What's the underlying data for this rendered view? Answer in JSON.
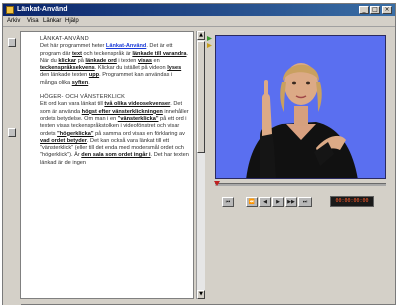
{
  "window": {
    "title": "Länkat-Använd",
    "controls": {
      "minimize": "_",
      "maximize": "□",
      "close": "×"
    }
  },
  "menubar": {
    "items": [
      "Arkiv",
      "Visa",
      "Länkar",
      "Hjälp"
    ]
  },
  "document": {
    "heading1": "LÄNKAT-ANVÄND",
    "para1": [
      {
        "t": "Det här programmet heter ",
        "s": "n"
      },
      {
        "t": "Länkat-Använd",
        "s": "l"
      },
      {
        "t": ". Det är ett program där ",
        "s": "n"
      },
      {
        "t": "text",
        "s": "b"
      },
      {
        "t": " och teckenspråk är ",
        "s": "n"
      },
      {
        "t": "länkade till varandra",
        "s": "b"
      },
      {
        "t": ". När du ",
        "s": "n"
      },
      {
        "t": "klickar",
        "s": "b"
      },
      {
        "t": " på ",
        "s": "n"
      },
      {
        "t": "länkade ord",
        "s": "b"
      },
      {
        "t": " i texten ",
        "s": "n"
      },
      {
        "t": "visas",
        "s": "b"
      },
      {
        "t": " en ",
        "s": "n"
      },
      {
        "t": "teckenspråksekvens",
        "s": "b"
      },
      {
        "t": ". Klickar du istället på videon ",
        "s": "n"
      },
      {
        "t": "lyses",
        "s": "b"
      },
      {
        "t": " den länkade texten ",
        "s": "n"
      },
      {
        "t": "upp",
        "s": "b"
      },
      {
        "t": ". Programmet kan användas i många olika ",
        "s": "n"
      },
      {
        "t": "syften",
        "s": "b"
      },
      {
        "t": ".",
        "s": "n"
      }
    ],
    "heading2": "HÖGER- OCH VÄNSTERKLICK",
    "para2": [
      {
        "t": "Ett ord kan vara länkat till ",
        "s": "n"
      },
      {
        "t": "två olika videosekvenser",
        "s": "b"
      },
      {
        "t": ". Det som är använda ",
        "s": "n"
      },
      {
        "t": "högst efter vänsterklickningen",
        "s": "b"
      },
      {
        "t": " innehåller ordets betydelse. Om man i en ",
        "s": "n"
      },
      {
        "t": "\"vänsterklicka\"",
        "s": "b"
      },
      {
        "t": " på ett ord i texten visas teckenspråkstolken i videofönstret och visar ordets ",
        "s": "n"
      },
      {
        "t": "\"högerklicka\"",
        "s": "b"
      },
      {
        "t": " på samma ord visas en förklaring av ",
        "s": "n"
      },
      {
        "t": "vad ordet betyder",
        "s": "b"
      },
      {
        "t": ". Det kan också vara länkat till ett \"vänsterklick\" (eller till det enda med modersmål ordet och \"högerklick\"). Är ",
        "s": "n"
      },
      {
        "t": "den sala som ordet ingår i",
        "s": "b"
      },
      {
        "t": ". Det har texten länkad är de ingen",
        "s": "n"
      }
    ]
  },
  "player": {
    "controls": [
      "⏮",
      "⏪",
      "◀",
      "▶",
      "▶▶",
      "⏭"
    ],
    "timecode": "00:00:00:00"
  },
  "colors": {
    "video_bg": "#5a6ff0",
    "link": "#1a3ad8",
    "timecode": "#ff5a2a",
    "titlebar": "#0a246a"
  }
}
